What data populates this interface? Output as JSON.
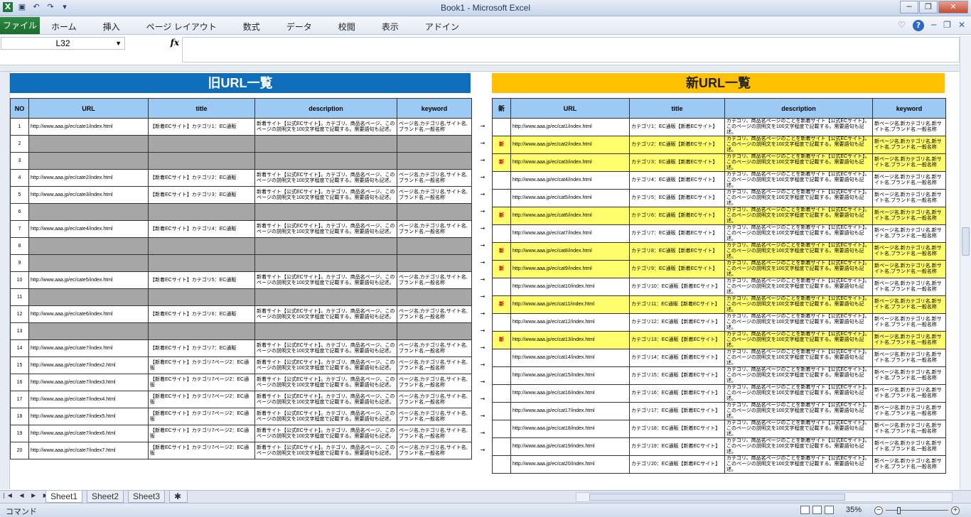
{
  "window": {
    "title": "Book1 - Microsoft Excel"
  },
  "ribbon": {
    "file_tab": "ファイル",
    "tabs": [
      "ホーム",
      "挿入",
      "ページ レイアウト",
      "数式",
      "データ",
      "校閲",
      "表示",
      "アドイン"
    ]
  },
  "formula_bar": {
    "name_box": "L32",
    "fx_label": "fx",
    "formula": ""
  },
  "sheet": {
    "old_banner": "旧URL一覧",
    "new_banner": "新URL一覧",
    "old_headers": [
      "NO",
      "URL",
      "title",
      "description",
      "keyword"
    ],
    "new_headers": [
      "新",
      "URL",
      "title",
      "description",
      "keyword"
    ],
    "arrow": "→",
    "old_rows": [
      {
        "no": "1",
        "url": "http://www.aaa.jp/ec/cate1/index.html",
        "title": "【新着ECサイト】カテゴリ1：EC通販",
        "desc": "新着サイト【公式ECサイト】。カテゴリ、商品名ページ、このページの説明文を100文字程度で記載する。需要語句も記述。",
        "kw": "ページ名,カテゴリ名,サイト名,ブランド名,一般名称",
        "gray": false
      },
      {
        "no": "2",
        "url": "",
        "title": "",
        "desc": "",
        "kw": "",
        "gray": true
      },
      {
        "no": "3",
        "url": "",
        "title": "",
        "desc": "",
        "kw": "",
        "gray": true
      },
      {
        "no": "4",
        "url": "http://www.aaa.jp/ec/cate2/index.html",
        "title": "【新着ECサイト】カテゴリ2：EC通販",
        "desc": "新着サイト【公式ECサイト】。カテゴリ、商品名ページ、このページの説明文を100文字程度で記載する。需要語句も記述。",
        "kw": "ページ名,カテゴリ名,サイト名,ブランド名,一般名称",
        "gray": false
      },
      {
        "no": "5",
        "url": "http://www.aaa.jp/ec/cate3/index.html",
        "title": "【新着ECサイト】カテゴリ3：EC通販",
        "desc": "新着サイト【公式ECサイト】。カテゴリ、商品名ページ、このページの説明文を100文字程度で記載する。需要語句も記述。",
        "kw": "ページ名,カテゴリ名,サイト名,ブランド名,一般名称",
        "gray": false
      },
      {
        "no": "6",
        "url": "",
        "title": "",
        "desc": "",
        "kw": "",
        "gray": true
      },
      {
        "no": "7",
        "url": "http://www.aaa.jp/ec/cate4/index.html",
        "title": "【新着ECサイト】カテゴリ4：EC通販",
        "desc": "新着サイト【公式ECサイト】。カテゴリ、商品名ページ、このページの説明文を100文字程度で記載する。需要語句も記述。",
        "kw": "ページ名,カテゴリ名,サイト名,ブランド名,一般名称",
        "gray": false
      },
      {
        "no": "8",
        "url": "",
        "title": "",
        "desc": "",
        "kw": "",
        "gray": true
      },
      {
        "no": "9",
        "url": "",
        "title": "",
        "desc": "",
        "kw": "",
        "gray": true
      },
      {
        "no": "10",
        "url": "http://www.aaa.jp/ec/cate5/index.html",
        "title": "【新着ECサイト】カテゴリ5：EC通販",
        "desc": "新着サイト【公式ECサイト】。カテゴリ、商品名ページ、このページの説明文を100文字程度で記載する。需要語句も記述。",
        "kw": "ページ名,カテゴリ名,サイト名,ブランド名,一般名称",
        "gray": false
      },
      {
        "no": "11",
        "url": "",
        "title": "",
        "desc": "",
        "kw": "",
        "gray": true
      },
      {
        "no": "12",
        "url": "http://www.aaa.jp/ec/cate6/index.html",
        "title": "【新着ECサイト】カテゴリ6：EC通販",
        "desc": "新着サイト【公式ECサイト】。カテゴリ、商品名ページ、このページの説明文を100文字程度で記載する。需要語句も記述。",
        "kw": "ページ名,カテゴリ名,サイト名,ブランド名,一般名称",
        "gray": false
      },
      {
        "no": "13",
        "url": "",
        "title": "",
        "desc": "",
        "kw": "",
        "gray": true
      },
      {
        "no": "14",
        "url": "http://www.aaa.jp/ec/cate7/index.html",
        "title": "【新着ECサイト】カテゴリ7：EC通販",
        "desc": "新着サイト【公式ECサイト】。カテゴリ、商品名ページ、このページの説明文を100文字程度で記載する。需要語句も記述。",
        "kw": "ページ名,カテゴリ名,サイト名,ブランド名,一般名称",
        "gray": false
      },
      {
        "no": "15",
        "url": "http://www.aaa.jp/ec/cate7/index2.html",
        "title": "【新着ECサイト】カテゴリ7ページ2：EC通販",
        "desc": "新着サイト【公式ECサイト】。カテゴリ、商品名ページ、このページの説明文を100文字程度で記載する。需要語句も記述。",
        "kw": "ページ名,カテゴリ名,サイト名,ブランド名,一般名称",
        "gray": false
      },
      {
        "no": "16",
        "url": "http://www.aaa.jp/ec/cate7/index3.html",
        "title": "【新着ECサイト】カテゴリ7ページ2：EC通販",
        "desc": "新着サイト【公式ECサイト】。カテゴリ、商品名ページ、このページの説明文を100文字程度で記載する。需要語句も記述。",
        "kw": "ページ名,カテゴリ名,サイト名,ブランド名,一般名称",
        "gray": false
      },
      {
        "no": "17",
        "url": "http://www.aaa.jp/ec/cate7/index4.html",
        "title": "【新着ECサイト】カテゴリ7ページ2：EC通販",
        "desc": "新着サイト【公式ECサイト】。カテゴリ、商品名ページ、このページの説明文を100文字程度で記載する。需要語句も記述。",
        "kw": "ページ名,カテゴリ名,サイト名,ブランド名,一般名称",
        "gray": false
      },
      {
        "no": "18",
        "url": "http://www.aaa.jp/ec/cate7/index5.html",
        "title": "【新着ECサイト】カテゴリ7ページ2：EC通販",
        "desc": "新着サイト【公式ECサイト】。カテゴリ、商品名ページ、このページの説明文を100文字程度で記載する。需要語句も記述。",
        "kw": "ページ名,カテゴリ名,サイト名,ブランド名,一般名称",
        "gray": false
      },
      {
        "no": "19",
        "url": "http://www.aaa.jp/ec/cate7/index6.html",
        "title": "【新着ECサイト】カテゴリ7ページ2：EC通販",
        "desc": "新着サイト【公式ECサイト】。カテゴリ、商品名ページ、このページの説明文を100文字程度で記載する。需要語句も記述。",
        "kw": "ページ名,カテゴリ名,サイト名,ブランド名,一般名称",
        "gray": false
      },
      {
        "no": "20",
        "url": "http://www.aaa.jp/ec/cate7/index7.html",
        "title": "【新着ECサイト】カテゴリ7ページ2：EC通販",
        "desc": "新着サイト【公式ECサイト】。カテゴリ、商品名ページ、このページの説明文を100文字程度で記載する。需要語句も記述。",
        "kw": "ページ名,カテゴリ名,サイト名,ブランド名,一般名称",
        "gray": false
      }
    ],
    "new_rows": [
      {
        "flag": "",
        "url": "http://www.aaa.jp/ec/cat1/index.html",
        "title": "カテゴリ1：EC通販【新着ECサイト】",
        "desc": "カテゴリ、商品名ページのことを新着サイト【公式ECサイト】。このページの説明文を100文字程度で記載する。需要語句も記述。",
        "kw": "新ページ名,新カテゴリ名,新サイト名,ブランド名,一般名称",
        "new": false
      },
      {
        "flag": "新",
        "url": "http://www.aaa.jp/ec/cat2/index.html",
        "title": "カテゴリ2：EC通販【新着ECサイト】",
        "desc": "カテゴリ、商品名ページのことを新着サイト【公式ECサイト】。このページの説明文を100文字程度で記載する。需要語句も記述。",
        "kw": "新ページ名,新カテゴリ名,新サイト名,ブランド名,一般名称",
        "new": true
      },
      {
        "flag": "新",
        "url": "http://www.aaa.jp/ec/cat3/index.html",
        "title": "カテゴリ3：EC通販【新着ECサイト】",
        "desc": "カテゴリ、商品名ページのことを新着サイト【公式ECサイト】。このページの説明文を100文字程度で記載する。需要語句も記述。",
        "kw": "新ページ名,新カテゴリ名,新サイト名,ブランド名,一般名称",
        "new": true
      },
      {
        "flag": "",
        "url": "http://www.aaa.jp/ec/cat4/index.html",
        "title": "カテゴリ4：EC通販【新着ECサイト】",
        "desc": "カテゴリ、商品名ページのことを新着サイト【公式ECサイト】。このページの説明文を100文字程度で記載する。需要語句も記述。",
        "kw": "新ページ名,新カテゴリ名,新サイト名,ブランド名,一般名称",
        "new": false
      },
      {
        "flag": "",
        "url": "http://www.aaa.jp/ec/cat5/index.html",
        "title": "カテゴリ5：EC通販【新着ECサイト】",
        "desc": "カテゴリ、商品名ページのことを新着サイト【公式ECサイト】。このページの説明文を100文字程度で記載する。需要語句も記述。",
        "kw": "新ページ名,新カテゴリ名,新サイト名,ブランド名,一般名称",
        "new": false
      },
      {
        "flag": "新",
        "url": "http://www.aaa.jp/ec/cat6/index.html",
        "title": "カテゴリ6：EC通販【新着ECサイト】",
        "desc": "カテゴリ、商品名ページのことを新着サイト【公式ECサイト】。このページの説明文を100文字程度で記載する。需要語句も記述。",
        "kw": "新ページ名,新カテゴリ名,新サイト名,ブランド名,一般名称",
        "new": true
      },
      {
        "flag": "",
        "url": "http://www.aaa.jp/ec/cat7/index.html",
        "title": "カテゴリ7：EC通販【新着ECサイト】",
        "desc": "カテゴリ、商品名ページのことを新着サイト【公式ECサイト】。このページの説明文を100文字程度で記載する。需要語句も記述。",
        "kw": "新ページ名,新カテゴリ名,新サイト名,ブランド名,一般名称",
        "new": false
      },
      {
        "flag": "新",
        "url": "http://www.aaa.jp/ec/cat8/index.html",
        "title": "カテゴリ8：EC通販【新着ECサイト】",
        "desc": "カテゴリ、商品名ページのことを新着サイト【公式ECサイト】。このページの説明文を100文字程度で記載する。需要語句も記述。",
        "kw": "新ページ名,新カテゴリ名,新サイト名,ブランド名,一般名称",
        "new": true
      },
      {
        "flag": "新",
        "url": "http://www.aaa.jp/ec/cat9/index.html",
        "title": "カテゴリ9：EC通販【新着ECサイト】",
        "desc": "カテゴリ、商品名ページのことを新着サイト【公式ECサイト】。このページの説明文を100文字程度で記載する。需要語句も記述。",
        "kw": "新ページ名,新カテゴリ名,新サイト名,ブランド名,一般名称",
        "new": true
      },
      {
        "flag": "",
        "url": "http://www.aaa.jp/ec/cat10/index.html",
        "title": "カテゴリ10：EC通販【新着ECサイト】",
        "desc": "カテゴリ、商品名ページのことを新着サイト【公式ECサイト】。このページの説明文を100文字程度で記載する。需要語句も記述。",
        "kw": "新ページ名,新カテゴリ名,新サイト名,ブランド名,一般名称",
        "new": false
      },
      {
        "flag": "新",
        "url": "http://www.aaa.jp/ec/cat11/index.html",
        "title": "カテゴリ11：EC通販【新着ECサイト】",
        "desc": "カテゴリ、商品名ページのことを新着サイト【公式ECサイト】。このページの説明文を100文字程度で記載する。需要語句も記述。",
        "kw": "新ページ名,新カテゴリ名,新サイト名,ブランド名,一般名称",
        "new": true
      },
      {
        "flag": "",
        "url": "http://www.aaa.jp/ec/cat12/index.html",
        "title": "カテゴリ12：EC通販【新着ECサイト】",
        "desc": "カテゴリ、商品名ページのことを新着サイト【公式ECサイト】。このページの説明文を100文字程度で記載する。需要語句も記述。",
        "kw": "新ページ名,新カテゴリ名,新サイト名,ブランド名,一般名称",
        "new": false
      },
      {
        "flag": "新",
        "url": "http://www.aaa.jp/ec/cat13/index.html",
        "title": "カテゴリ13：EC通販【新着ECサイト】",
        "desc": "カテゴリ、商品名ページのことを新着サイト【公式ECサイト】。このページの説明文を100文字程度で記載する。需要語句も記述。",
        "kw": "新ページ名,新カテゴリ名,新サイト名,ブランド名,一般名称",
        "new": true
      },
      {
        "flag": "",
        "url": "http://www.aaa.jp/ec/cat14/index.html",
        "title": "カテゴリ14：EC通販【新着ECサイト】",
        "desc": "カテゴリ、商品名ページのことを新着サイト【公式ECサイト】。このページの説明文を100文字程度で記載する。需要語句も記述。",
        "kw": "新ページ名,新カテゴリ名,新サイト名,ブランド名,一般名称",
        "new": false
      },
      {
        "flag": "",
        "url": "http://www.aaa.jp/ec/cat15/index.html",
        "title": "カテゴリ15：EC通販【新着ECサイト】",
        "desc": "カテゴリ、商品名ページのことを新着サイト【公式ECサイト】。このページの説明文を100文字程度で記載する。需要語句も記述。",
        "kw": "新ページ名,新カテゴリ名,新サイト名,ブランド名,一般名称",
        "new": false
      },
      {
        "flag": "",
        "url": "http://www.aaa.jp/ec/cat16/index.html",
        "title": "カテゴリ16：EC通販【新着ECサイト】",
        "desc": "カテゴリ、商品名ページのことを新着サイト【公式ECサイト】。このページの説明文を100文字程度で記載する。需要語句も記述。",
        "kw": "新ページ名,新カテゴリ名,新サイト名,ブランド名,一般名称",
        "new": false
      },
      {
        "flag": "",
        "url": "http://www.aaa.jp/ec/cat17/index.html",
        "title": "カテゴリ17：EC通販【新着ECサイト】",
        "desc": "カテゴリ、商品名ページのことを新着サイト【公式ECサイト】。このページの説明文を100文字程度で記載する。需要語句も記述。",
        "kw": "新ページ名,新カテゴリ名,新サイト名,ブランド名,一般名称",
        "new": false
      },
      {
        "flag": "",
        "url": "http://www.aaa.jp/ec/cat18/index.html",
        "title": "カテゴリ18：EC通販【新着ECサイト】",
        "desc": "カテゴリ、商品名ページのことを新着サイト【公式ECサイト】。このページの説明文を100文字程度で記載する。需要語句も記述。",
        "kw": "新ページ名,新カテゴリ名,新サイト名,ブランド名,一般名称",
        "new": false
      },
      {
        "flag": "",
        "url": "http://www.aaa.jp/ec/cat19/index.html",
        "title": "カテゴリ19：EC通販【新着ECサイト】",
        "desc": "カテゴリ、商品名ページのことを新着サイト【公式ECサイト】。このページの説明文を100文字程度で記載する。需要語句も記述。",
        "kw": "新ページ名,新カテゴリ名,新サイト名,ブランド名,一般名称",
        "new": false
      },
      {
        "flag": "",
        "url": "http://www.aaa.jp/ec/cat20/index.html",
        "title": "カテゴリ20：EC通販【新着ECサイト】",
        "desc": "カテゴリ、商品名ページのことを新着サイト【公式ECサイト】。このページの説明文を100文字程度で記載する。需要語句も記述。",
        "kw": "新ページ名,新カテゴリ名,新サイト名,ブランド名,一般名称",
        "new": false
      }
    ]
  },
  "sheet_tabs": [
    "Sheet1",
    "Sheet2",
    "Sheet3"
  ],
  "status": {
    "mode": "コマンド",
    "zoom": "35%"
  },
  "colors": {
    "old_banner": "#0f6ebc",
    "new_banner": "#ffc000",
    "header_fill": "#9ccaf5",
    "removed_fill": "#a6a6a6",
    "new_fill": "#fffd6b",
    "new_flag": "#c00000"
  }
}
